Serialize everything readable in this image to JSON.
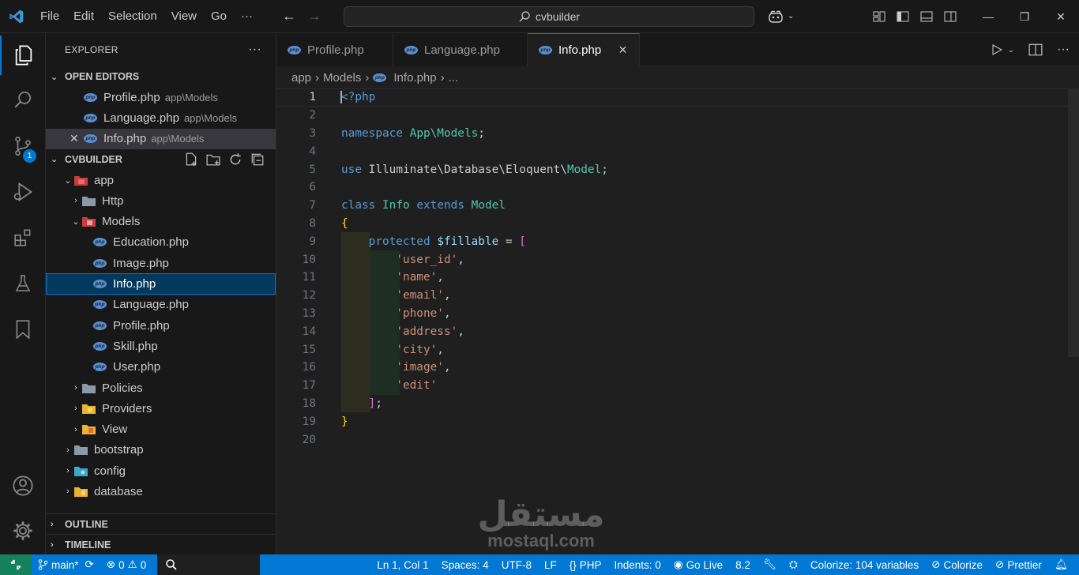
{
  "titlebar": {
    "menu": [
      "File",
      "Edit",
      "Selection",
      "View",
      "Go",
      "···"
    ],
    "search_text": "cvbuilder",
    "colors": {
      "accent": "#0078d4",
      "vscode_logo": "#3c99d4"
    }
  },
  "activity_bar": {
    "items": [
      "explorer-icon",
      "search-icon",
      "source-control-icon",
      "run-debug-icon",
      "extensions-icon",
      "testing-icon",
      "bookmarks-icon"
    ],
    "scm_badge": "1",
    "bottom": [
      "accounts-icon",
      "manage-gear-icon"
    ]
  },
  "sidebar": {
    "title": "EXPLORER",
    "title_more": "···",
    "open_editors": {
      "header": "OPEN EDITORS",
      "items": [
        {
          "name": "Profile.php",
          "path": "app\\Models"
        },
        {
          "name": "Language.php",
          "path": "app\\Models"
        },
        {
          "name": "Info.php",
          "path": "app\\Models"
        }
      ]
    },
    "project": {
      "header": "CVBUILDER",
      "tree": [
        {
          "label": "app",
          "chev": "⌄"
        },
        {
          "label": "Http",
          "chev": "›"
        },
        {
          "label": "Models",
          "chev": "⌄"
        },
        {
          "label": "Education.php"
        },
        {
          "label": "Image.php"
        },
        {
          "label": "Info.php"
        },
        {
          "label": "Language.php"
        },
        {
          "label": "Profile.php"
        },
        {
          "label": "Skill.php"
        },
        {
          "label": "User.php"
        },
        {
          "label": "Policies",
          "chev": "›"
        },
        {
          "label": "Providers",
          "chev": "›"
        },
        {
          "label": "View",
          "chev": "›"
        },
        {
          "label": "bootstrap",
          "chev": "›"
        },
        {
          "label": "config",
          "chev": "›"
        },
        {
          "label": "database",
          "chev": "›"
        }
      ]
    },
    "outline": "OUTLINE",
    "timeline": "TIMELINE"
  },
  "editor": {
    "tabs": [
      {
        "label": "Profile.php"
      },
      {
        "label": "Language.php"
      },
      {
        "label": "Info.php",
        "close": "×"
      }
    ],
    "breadcrumbs": [
      "app",
      "›",
      "Models",
      "›",
      "Info.php",
      "›",
      "..."
    ],
    "line_numbers": [
      "1",
      "2",
      "3",
      "4",
      "5",
      "6",
      "7",
      "8",
      "9",
      "10",
      "11",
      "12",
      "13",
      "14",
      "15",
      "16",
      "17",
      "18",
      "19",
      "20"
    ],
    "code": {
      "l1": "<?php",
      "l3a": "namespace",
      "l3b": "App\\Models",
      "l3c": ";",
      "l5a": "use",
      "l5b": "Illuminate\\Database\\Eloquent\\",
      "l5c": "Model",
      "l5d": ";",
      "l7a": "class",
      "l7b": "Info",
      "l7c": "extends",
      "l7d": "Model",
      "l8": "{",
      "l9a": "protected",
      "l9b": "$fillable",
      "l9c": " = ",
      "l9d": "[",
      "s10": "'user_id'",
      "s11": "'name'",
      "s12": "'email'",
      "s13": "'phone'",
      "s14": "'address'",
      "s15": "'city'",
      "s16": "'image'",
      "s17": "'edit'",
      "comma": ",",
      "l18a": "]",
      "l18b": ";",
      "l19": "}"
    }
  },
  "statusbar": {
    "branch": "main*",
    "errors": "0",
    "warnings": "0",
    "position": "Ln 1, Col 1",
    "spaces": "Spaces: 4",
    "encoding": "UTF-8",
    "eol": "LF",
    "language": "PHP",
    "indents": "Indents: 0",
    "golive": "Go Live",
    "php_version": "8.2",
    "colorize_vars": "Colorize: 104 variables",
    "colorize": "Colorize",
    "prettier": "Prettier"
  },
  "watermark": {
    "arabic": "مستقل",
    "latin": "mostaql.com"
  }
}
